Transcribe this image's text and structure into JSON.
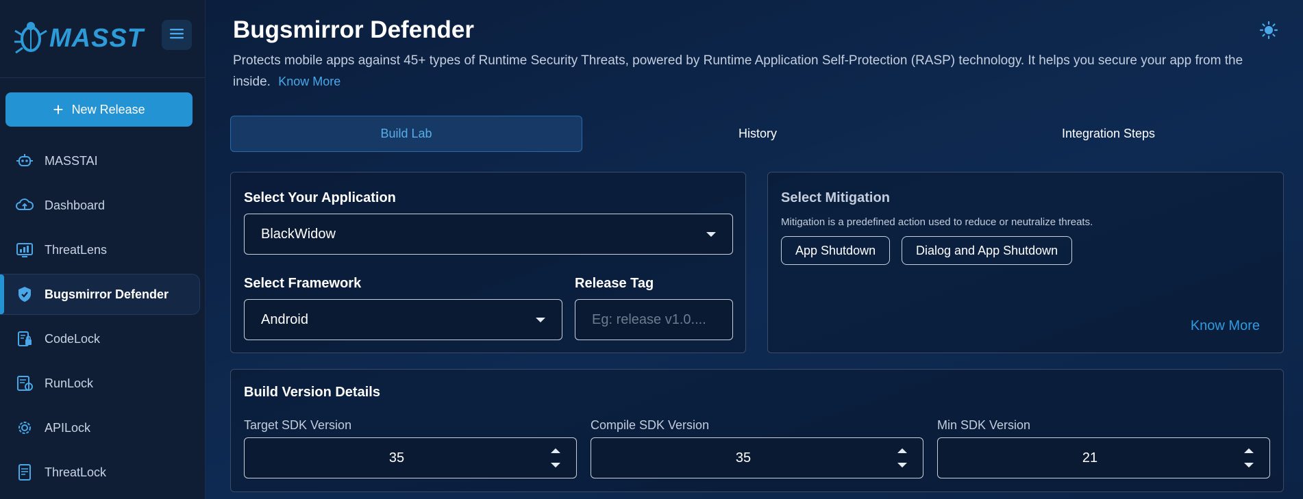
{
  "brand": {
    "name": "MASST"
  },
  "sidebar": {
    "new_release_label": "New Release",
    "items": [
      {
        "label": "MASSTAI",
        "icon": "robot-icon"
      },
      {
        "label": "Dashboard",
        "icon": "cloud-icon"
      },
      {
        "label": "ThreatLens",
        "icon": "monitor-chart-icon"
      },
      {
        "label": "Bugsmirror Defender",
        "icon": "shield-icon",
        "active": true
      },
      {
        "label": "CodeLock",
        "icon": "code-lock-icon"
      },
      {
        "label": "RunLock",
        "icon": "run-lock-icon"
      },
      {
        "label": "APILock",
        "icon": "api-gear-icon"
      },
      {
        "label": "ThreatLock",
        "icon": "threat-doc-icon"
      }
    ]
  },
  "header": {
    "title": "Bugsmirror Defender",
    "description": "Protects mobile apps against 45+ types of Runtime Security Threats, powered by Runtime Application Self-Protection (RASP) technology. It helps you secure your app from the inside.",
    "know_more": "Know More"
  },
  "tabs": [
    {
      "label": "Build Lab",
      "active": true
    },
    {
      "label": "History",
      "active": false
    },
    {
      "label": "Integration Steps",
      "active": false
    }
  ],
  "app_card": {
    "select_app_label": "Select Your Application",
    "select_app_value": "BlackWidow",
    "framework_label": "Select Framework",
    "framework_value": "Android",
    "release_tag_label": "Release Tag",
    "release_tag_placeholder": "Eg: release v1.0...."
  },
  "mitigation_card": {
    "title": "Select Mitigation",
    "description": "Mitigation is a predefined action used to reduce or neutralize threats.",
    "options": [
      "App Shutdown",
      "Dialog and App Shutdown"
    ],
    "know_more": "Know More"
  },
  "build_card": {
    "title": "Build Version Details",
    "target_label": "Target SDK Version",
    "target_value": "35",
    "compile_label": "Compile SDK Version",
    "compile_value": "35",
    "min_label": "Min SDK Version",
    "min_value": "21"
  },
  "colors": {
    "accent": "#2493d3",
    "link": "#4aa8e8",
    "sidebar_bg": "#0f1d35",
    "main_bg": "#0e2a52"
  }
}
